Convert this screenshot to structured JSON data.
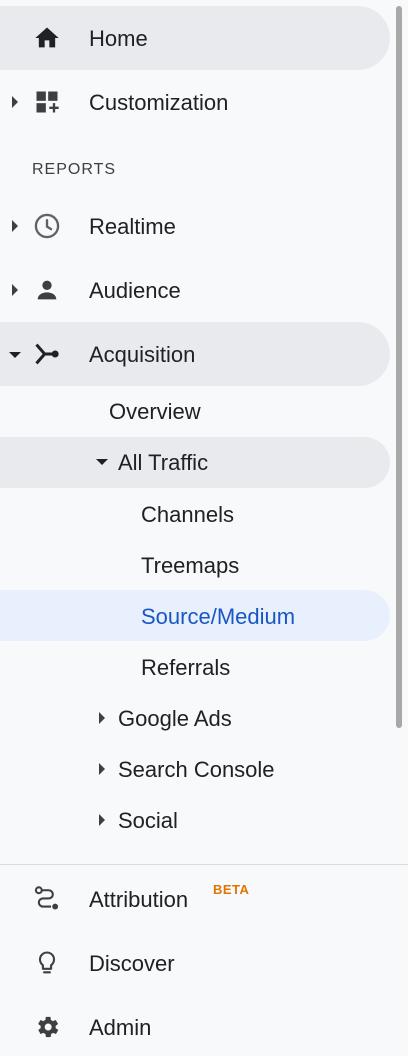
{
  "nav": {
    "home": "Home",
    "customization": "Customization",
    "reports_header": "REPORTS",
    "realtime": "Realtime",
    "audience": "Audience",
    "acquisition": "Acquisition",
    "overview": "Overview",
    "all_traffic": "All Traffic",
    "channels": "Channels",
    "treemaps": "Treemaps",
    "source_medium": "Source/Medium",
    "referrals": "Referrals",
    "google_ads": "Google Ads",
    "search_console": "Search Console",
    "social": "Social"
  },
  "bottom": {
    "attribution": "Attribution",
    "beta_badge": "BETA",
    "discover": "Discover",
    "admin": "Admin"
  },
  "colors": {
    "active_bg": "#e8f0fe",
    "active_text": "#1a56c4",
    "selected_bg": "#e8eaed",
    "beta": "#e37400"
  }
}
